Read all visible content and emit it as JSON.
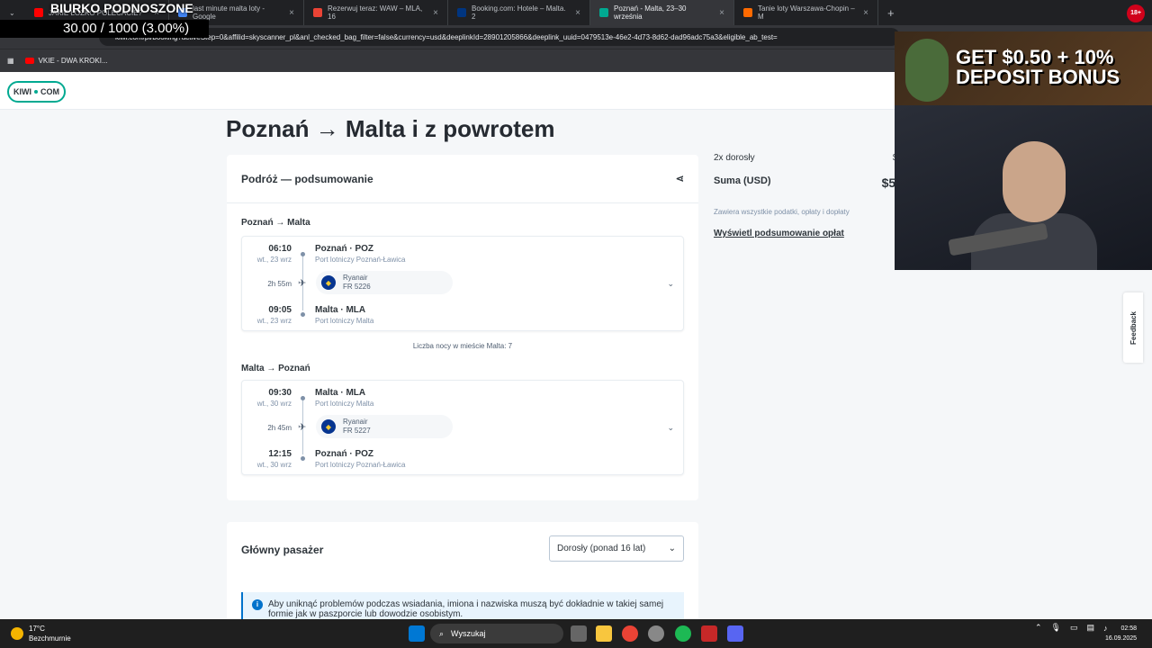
{
  "browser": {
    "tabs": [
      {
        "label": "JAKIE ŁÓŻKO POLECACIE?",
        "color": "#ff0000",
        "active": false
      },
      {
        "label": "last minute malta loty - Google",
        "color": "#4285f4",
        "active": false
      },
      {
        "label": "Rezerwuj teraz: WAW – MLA, 16",
        "color": "#ea4335",
        "active": false
      },
      {
        "label": "Booking.com: Hotele – Malta. 2",
        "color": "#003580",
        "active": false
      },
      {
        "label": "Poznań - Malta, 23–30 września",
        "color": "#00a991",
        "active": true
      },
      {
        "label": "Tanie loty Warszawa-Chopin – M",
        "color": "#ff6a00",
        "active": false
      }
    ],
    "url": "kiwi.com/pl/booking?activeStep=0&affilid=skyscanner_pl&anl_checked_bag_filter=false&currency=usd&deeplinkId=28901205866&deeplink_uuid=0479513e-46e2-4d73-8d62-dad96adc75a3&eligible_ab_test=",
    "bookmark": "VKIE - DWA KROKI..."
  },
  "stream": {
    "title": "BIURKO PODNOSZONE",
    "progress": "30.00 / 1000 (3.00%)",
    "ad": "GET $0.50 + 10% DEPOSIT BONUS",
    "badge": "18+"
  },
  "site": {
    "logo_left": "KIWI",
    "logo_right": "COM",
    "title": "Poznań → Malta i z powrotem",
    "summary": {
      "heading": "Podróż — podsumowanie",
      "outbound": {
        "title": "Poznań → Malta",
        "dep_time": "06:10",
        "dep_date": "wt., 23 wrz",
        "dep_place": "Poznań · POZ",
        "dep_airport": "Port lotniczy Poznań-Ławica",
        "duration": "2h 55m",
        "airline": "Ryanair",
        "flight": "FR 5226",
        "arr_time": "09:05",
        "arr_date": "wt., 23 wrz",
        "arr_place": "Malta · MLA",
        "arr_airport": "Port lotniczy Malta"
      },
      "nights": "Liczba nocy w mieście Malta: 7",
      "inbound": {
        "title": "Malta → Poznań",
        "dep_time": "09:30",
        "dep_date": "wt., 30 wrz",
        "dep_place": "Malta · MLA",
        "dep_airport": "Port lotniczy Malta",
        "duration": "2h 45m",
        "airline": "Ryanair",
        "flight": "FR 5227",
        "arr_time": "12:15",
        "arr_date": "wt., 30 wrz",
        "arr_place": "Poznań · POZ",
        "arr_airport": "Port lotniczy Poznań-Ławica"
      }
    },
    "passenger": {
      "heading": "Główny pasażer",
      "select": "Dorosły (ponad 16 lat)",
      "info": "Aby uniknąć problemów podczas wsiadania, imiona i nazwiska muszą być dokładnie w takiej samej formie jak w paszporcie lub dowodzie osobistym."
    },
    "sidebar": {
      "adults": "2x dorosły",
      "adults_price": "$5",
      "total_label": "Suma (USD)",
      "total_price": "$55",
      "tax": "Zawiera wszystkie podatki, opłaty i dopłaty",
      "link": "Wyświetl podsumowanie opłat"
    },
    "feedback": "Feedback"
  },
  "taskbar": {
    "temp": "17°C",
    "weather": "Bezchmurnie",
    "search": "Wyszukaj",
    "time": "02:58",
    "date": "16.09.2025"
  }
}
